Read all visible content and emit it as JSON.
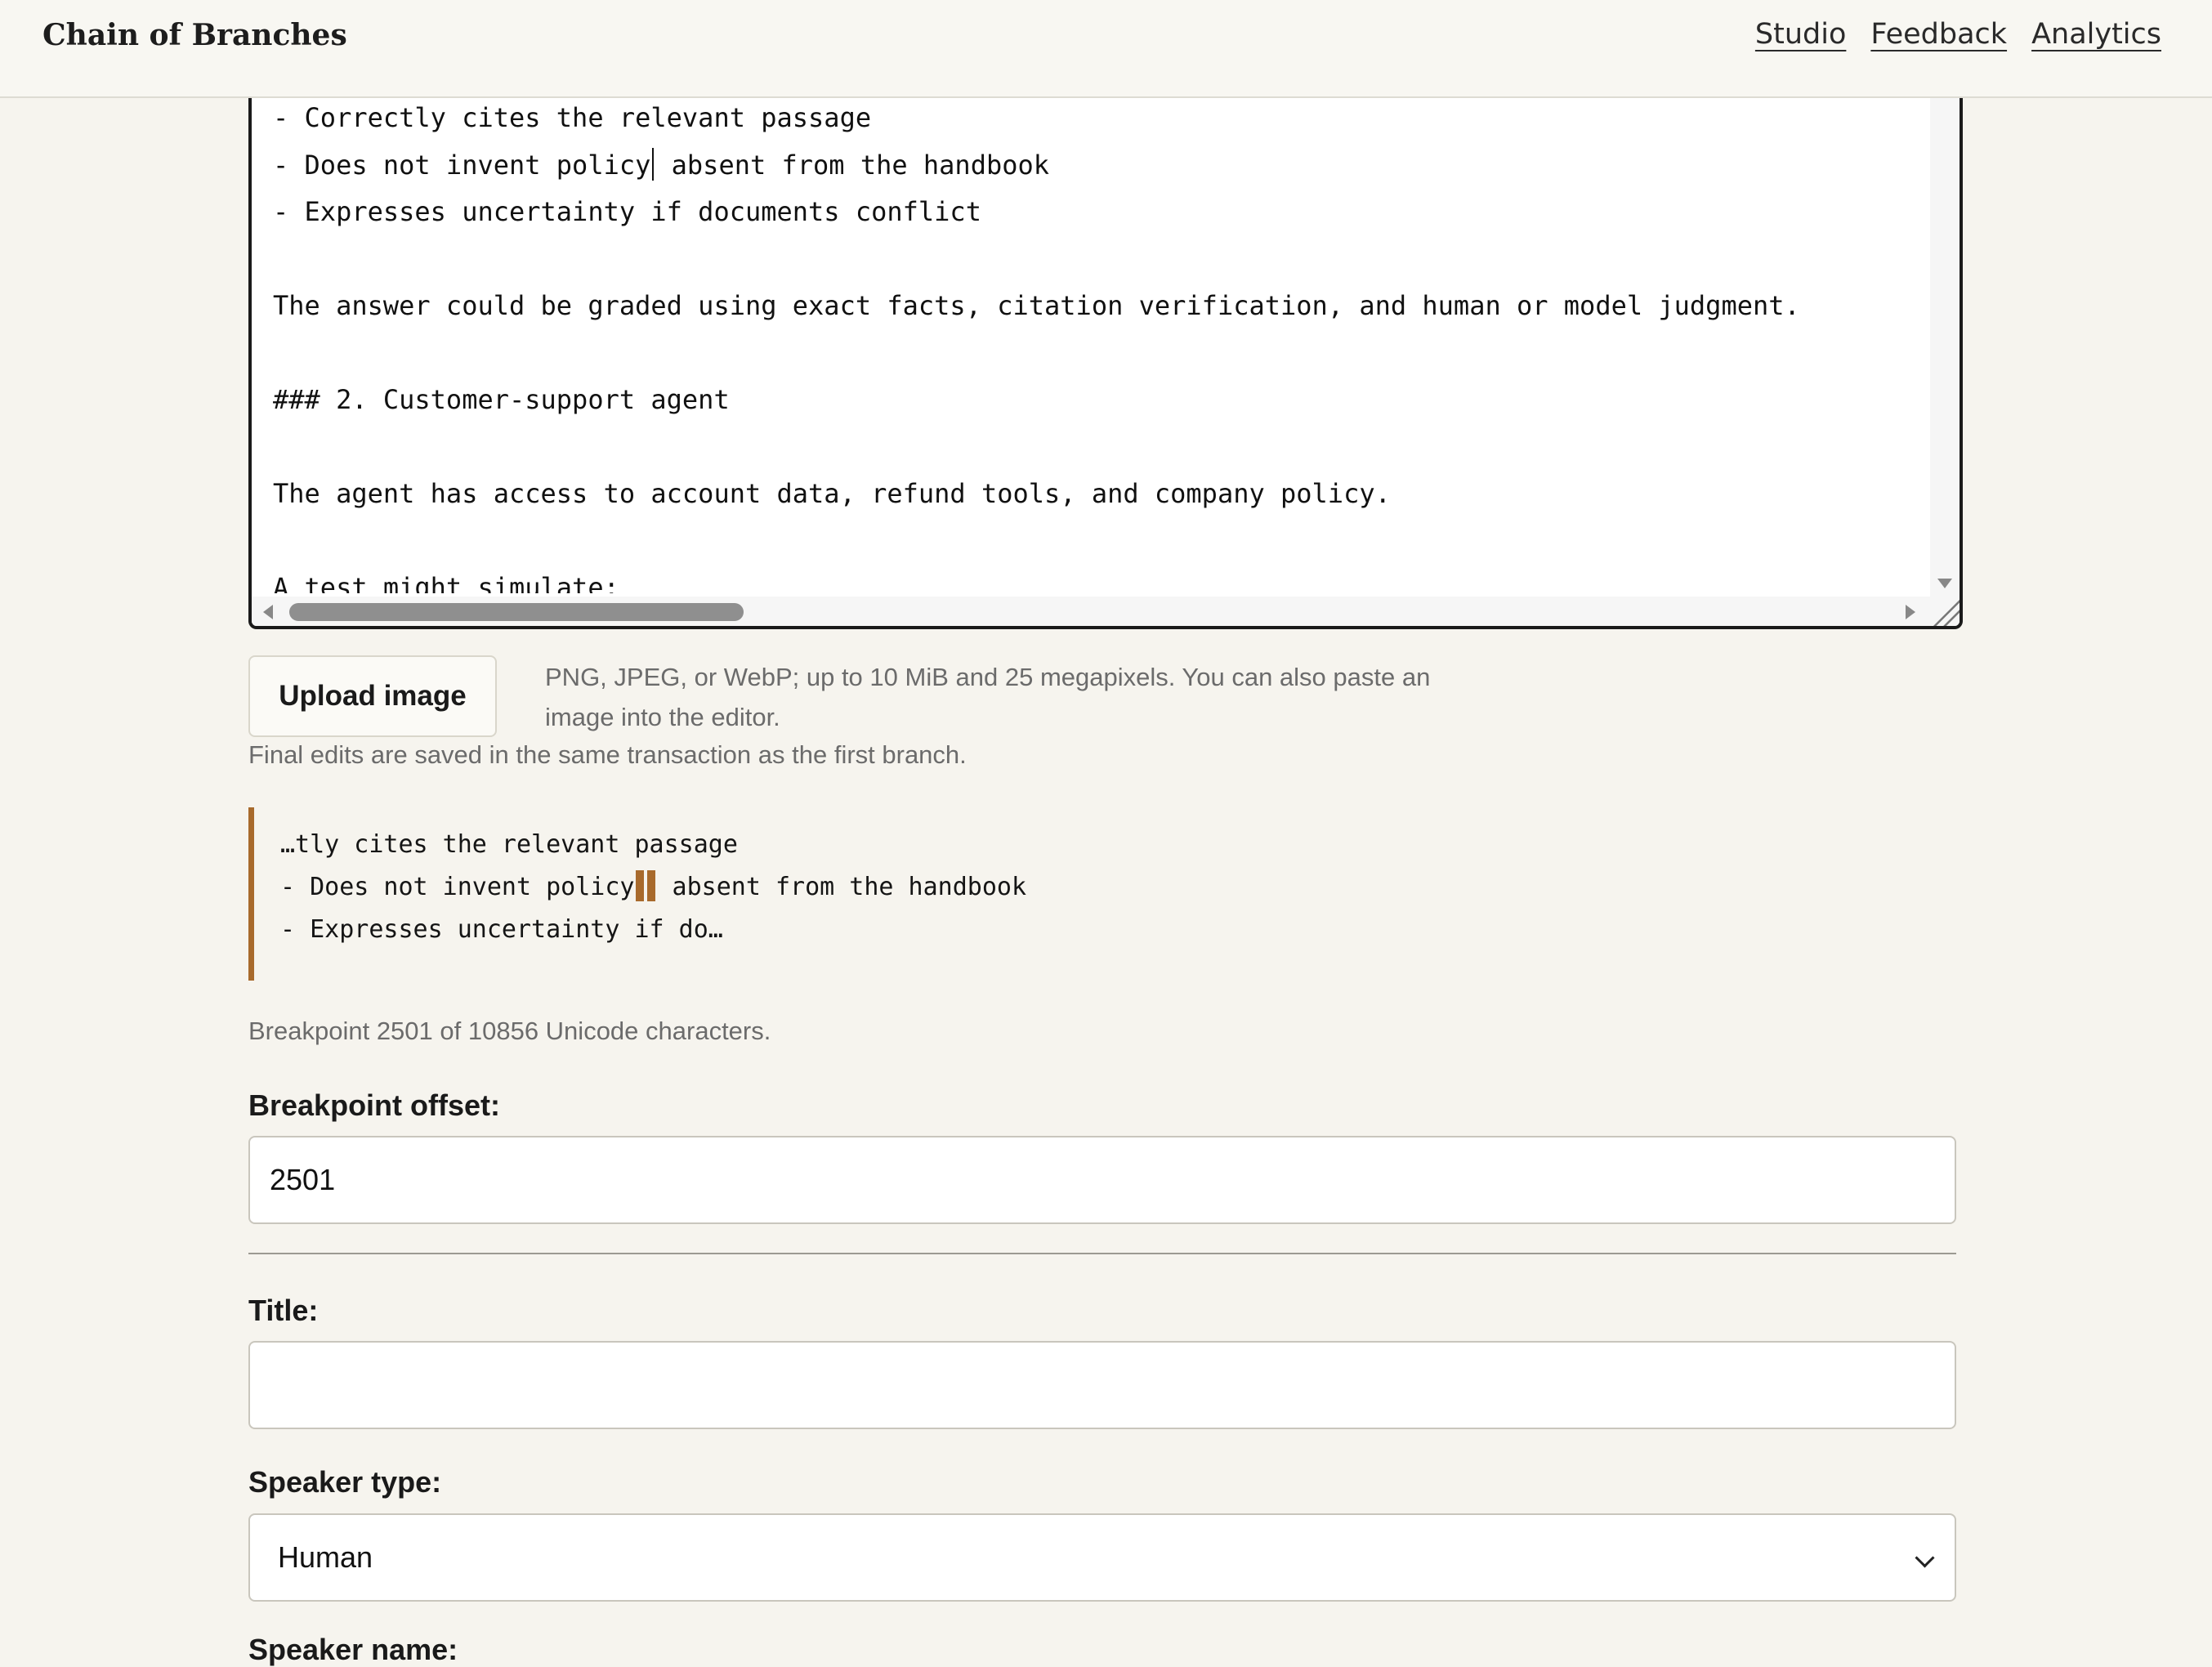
{
  "header": {
    "brand": "Chain of Branches",
    "nav": [
      "Studio",
      "Feedback",
      "Analytics"
    ]
  },
  "editor": {
    "lines_before_caret": "- Correctly cites the relevant passage\n- Does not invent policy",
    "line_after_caret": " absent from the handbook\n- Expresses uncertainty if documents conflict\n\nThe answer could be graded using exact facts, citation verification, and human or model judgment.\n\n### 2. Customer-support agent\n\nThe agent has access to account data, refund tools, and company policy.\n\nA test might simulate:"
  },
  "upload": {
    "button_label": "Upload image",
    "help": "PNG, JPEG, or WebP; up to 10 MiB and 25 megapixels. You can also paste an image into the editor.",
    "save_note": "Final edits are saved in the same transaction as the first branch."
  },
  "preview": {
    "before": "…tly cites the relevant passage\n- Does not invent policy",
    "after": " absent from the handbook\n- Expresses uncertainty if do…",
    "info": "Breakpoint 2501 of 10856 Unicode characters."
  },
  "form": {
    "breakpoint_label": "Breakpoint offset:",
    "breakpoint_value": "2501",
    "title_label": "Title:",
    "title_value": "",
    "speaker_type_label": "Speaker type:",
    "speaker_type_value": "Human",
    "speaker_name_label": "Speaker name:"
  }
}
